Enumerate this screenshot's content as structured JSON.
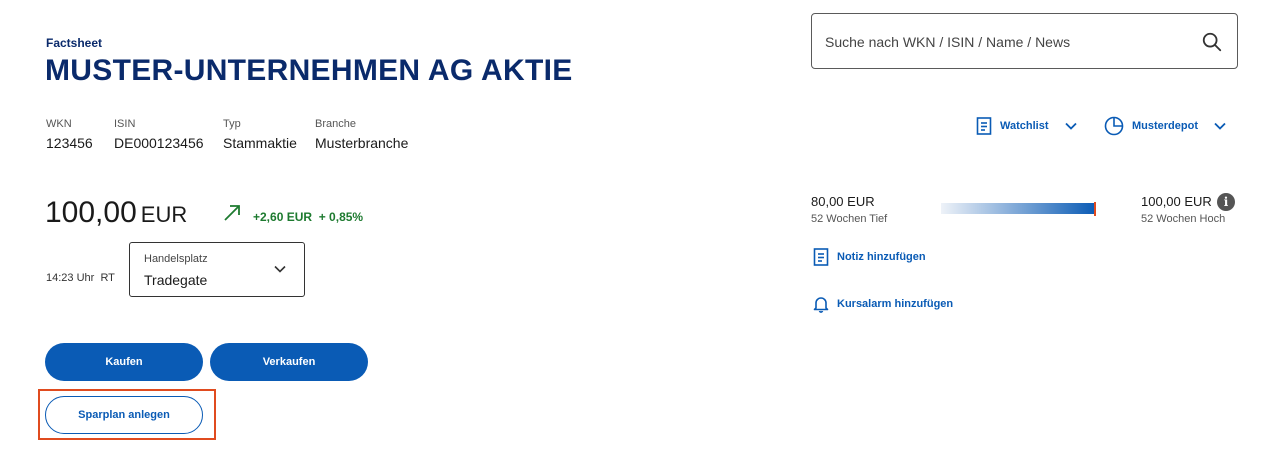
{
  "header": {
    "kicker": "Factsheet",
    "title": "MUSTER-UNTERNEHMEN AG AKTIE"
  },
  "search": {
    "placeholder": "Suche nach WKN / ISIN / Name / News",
    "icon": "search-icon"
  },
  "meta": {
    "wkn_label": "WKN",
    "wkn": "123456",
    "isin_label": "ISIN",
    "isin": "DE000123456",
    "typ_label": "Typ",
    "typ": "Stammaktie",
    "branche_label": "Branche",
    "branche": "Musterbranche"
  },
  "lists": {
    "watchlist": "Watchlist",
    "musterdepot": "Musterdepot"
  },
  "quote": {
    "price": "100,00",
    "currency": "EUR",
    "change_abs": "+2,60 EUR",
    "change_pct": "+ 0,85%",
    "time": "14:23 Uhr",
    "rt": "RT",
    "venue_label": "Handelsplatz",
    "venue_value": "Tradegate"
  },
  "range": {
    "low_value": "80,00 EUR",
    "low_label": "52 Wochen Tief",
    "high_value": "100,00 EUR",
    "high_label": "52 Wochen Hoch",
    "position_fraction": 1.0
  },
  "actions": {
    "note": "Notiz hinzufügen",
    "alarm": "Kursalarm hinzufügen",
    "buy": "Kaufen",
    "sell": "Verkaufen",
    "savings_plan": "Sparplan anlegen"
  },
  "colors": {
    "brand": "#0a2a6b",
    "accent": "#0a5bb5",
    "positive": "#1d7a2f",
    "highlight": "#e04b1f"
  }
}
